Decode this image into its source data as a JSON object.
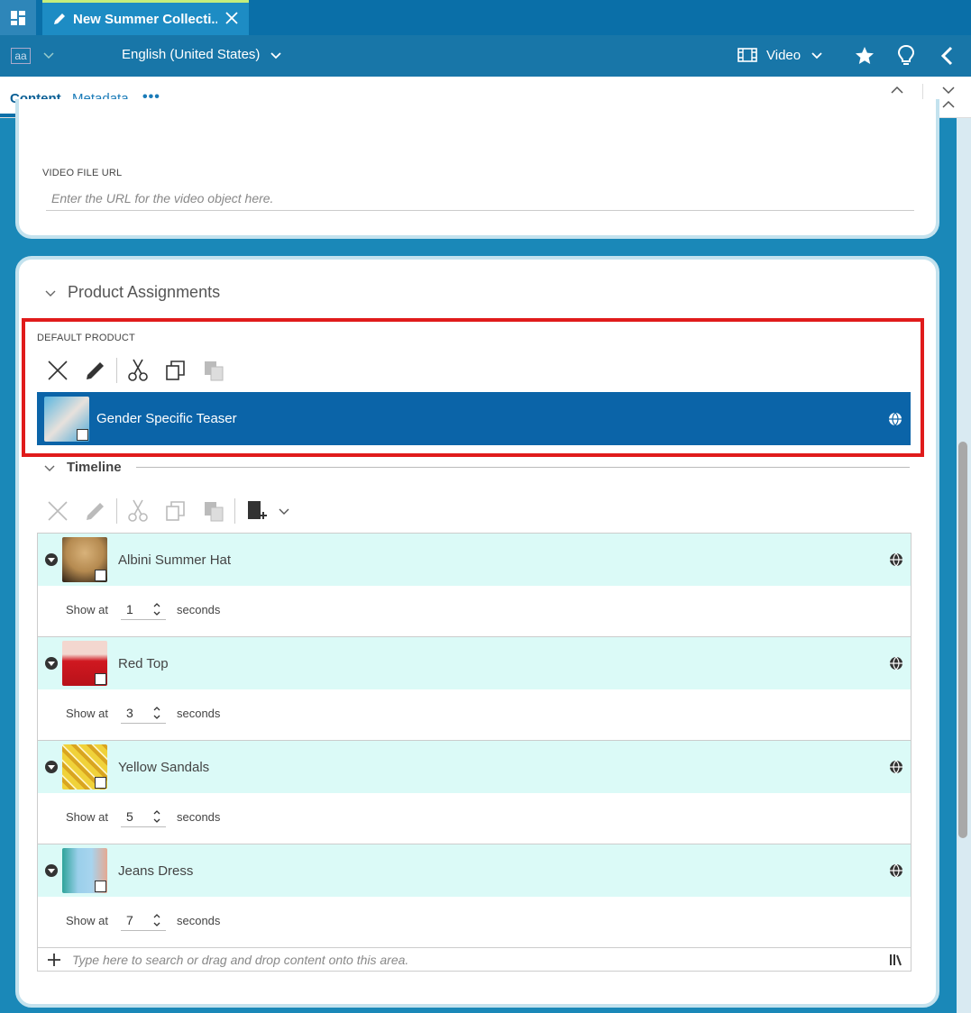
{
  "tab": {
    "title": "New Summer Collecti..."
  },
  "toolbar": {
    "language": "English (United States)",
    "doc_type": "Video",
    "aa_label": "aa"
  },
  "subtabs": {
    "content": "Content",
    "metadata": "Metadata",
    "more": "•••"
  },
  "video_section": {
    "url_label": "VIDEO FILE URL",
    "url_placeholder": "Enter the URL for the video object here."
  },
  "product_assignments": {
    "title": "Product Assignments",
    "default_label": "DEFAULT PRODUCT",
    "default_item": "Gender Specific Teaser"
  },
  "timeline": {
    "title": "Timeline",
    "show_at_label": "Show at",
    "seconds_label": "seconds",
    "items": [
      {
        "name": "Albini Summer Hat",
        "seconds": "1",
        "color": "#7a5a32"
      },
      {
        "name": "Red Top",
        "seconds": "3",
        "color": "#c8161c"
      },
      {
        "name": "Yellow Sandals",
        "seconds": "5",
        "color": "#e3c027"
      },
      {
        "name": "Jeans Dress",
        "seconds": "7",
        "color": "#8ec4e6"
      }
    ],
    "search_placeholder": "Type here to search or drag and drop content onto this area."
  },
  "colors": {
    "accent": "#0b64a8",
    "highlight": "#e01b1b",
    "row_bg": "#dbfaf7"
  }
}
